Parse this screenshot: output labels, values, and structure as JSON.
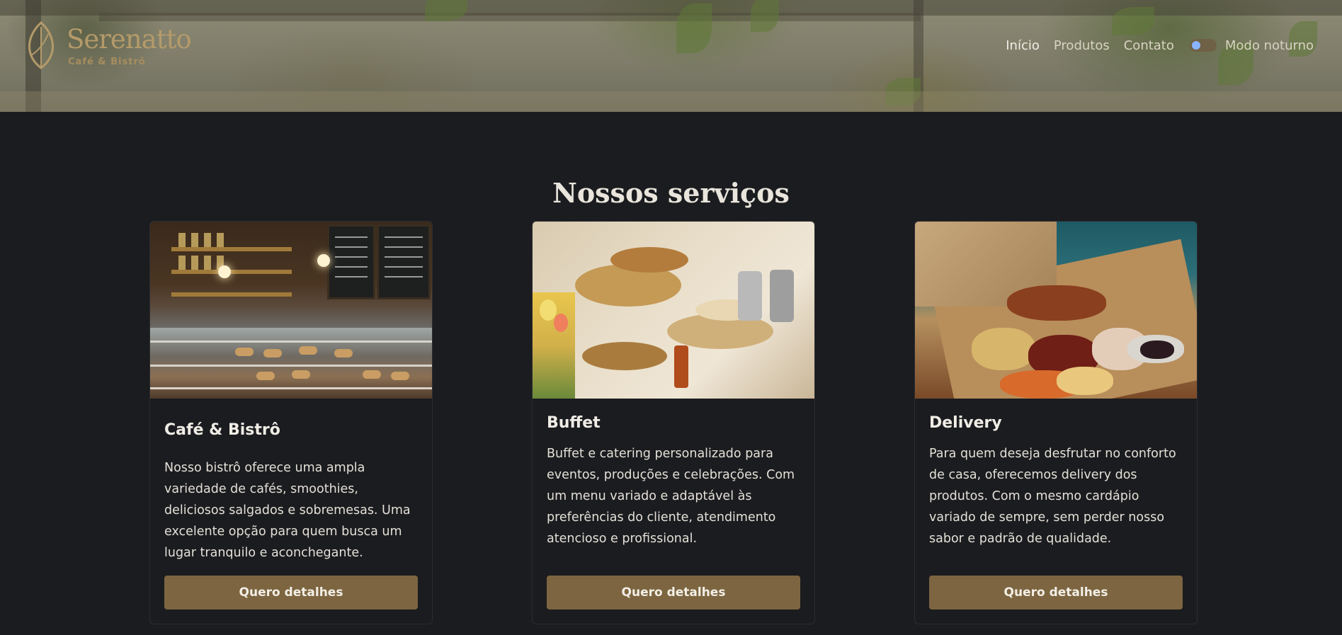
{
  "brand": {
    "name": "Serenatto",
    "tagline": "Café & Bistrô"
  },
  "nav": {
    "items": [
      "Início",
      "Produtos",
      "Contato"
    ],
    "toggle_label": "Modo noturno"
  },
  "services": {
    "title": "Nossos serviços",
    "cards": [
      {
        "title": "Café & Bistrô",
        "text": "Nosso bistrô oferece uma ampla variedade de cafés, smoothies, deliciosos salgados e sobremesas. Uma excelente opção para quem busca um lugar tranquilo e aconchegante.",
        "button": "Quero detalhes"
      },
      {
        "title": "Buffet",
        "text": "Buffet e catering personalizado para eventos, produções e celebrações. Com um menu variado e adaptável às preferências do cliente, atendimento atencioso e profissional.",
        "button": "Quero detalhes"
      },
      {
        "title": "Delivery",
        "text": "Para quem deseja desfrutar no conforto de casa, oferecemos delivery dos produtos. Com o mesmo cardápio variado de sempre, sem perder nosso sabor e padrão de qualidade.",
        "button": "Quero detalhes"
      }
    ]
  },
  "colors": {
    "background": "#1b1c1f",
    "accent": "#7c6540",
    "brand": "#b49a6a",
    "toggle_knob": "#8ab4ff"
  }
}
